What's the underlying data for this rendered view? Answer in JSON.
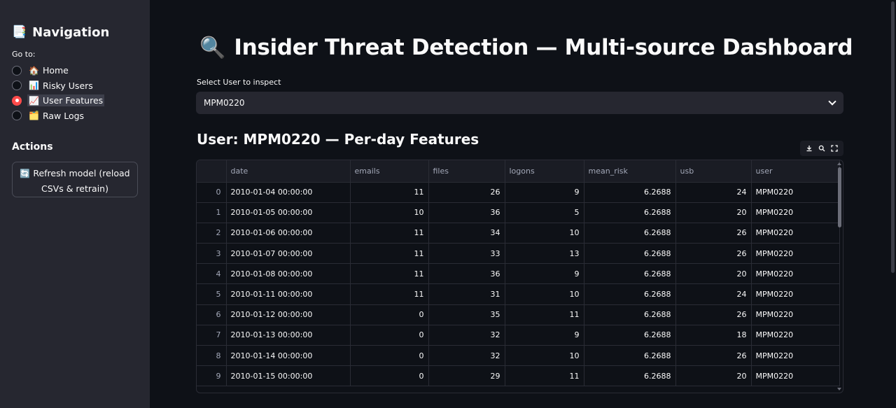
{
  "sidebar": {
    "title": "Navigation",
    "title_icon": "📑",
    "goto_label": "Go to:",
    "items": [
      {
        "label": "Home",
        "icon": "🏠",
        "selected": false
      },
      {
        "label": "Risky Users",
        "icon": "📊",
        "selected": false
      },
      {
        "label": "User Features",
        "icon": "📈",
        "selected": true
      },
      {
        "label": "Raw Logs",
        "icon": "🗂️",
        "selected": false
      }
    ],
    "actions_label": "Actions",
    "refresh_icon": "🔄",
    "refresh_line1": "Refresh model (reload",
    "refresh_line2": "CSVs & retrain)"
  },
  "main": {
    "title_icon": "🔍",
    "title": "Insider Threat Detection — Multi-source Dashboard",
    "select_label": "Select User to inspect",
    "selected_user": "MPM0220",
    "subheader": "User: MPM0220 — Per-day Features"
  },
  "table": {
    "columns": [
      "",
      "date",
      "emails",
      "files",
      "logons",
      "mean_risk",
      "usb",
      "user"
    ],
    "rows": [
      [
        "0",
        "2010-01-04 00:00:00",
        "11",
        "26",
        "9",
        "6.2688",
        "24",
        "MPM0220"
      ],
      [
        "1",
        "2010-01-05 00:00:00",
        "10",
        "36",
        "5",
        "6.2688",
        "20",
        "MPM0220"
      ],
      [
        "2",
        "2010-01-06 00:00:00",
        "11",
        "34",
        "10",
        "6.2688",
        "26",
        "MPM0220"
      ],
      [
        "3",
        "2010-01-07 00:00:00",
        "11",
        "33",
        "13",
        "6.2688",
        "26",
        "MPM0220"
      ],
      [
        "4",
        "2010-01-08 00:00:00",
        "11",
        "36",
        "9",
        "6.2688",
        "20",
        "MPM0220"
      ],
      [
        "5",
        "2010-01-11 00:00:00",
        "11",
        "31",
        "10",
        "6.2688",
        "24",
        "MPM0220"
      ],
      [
        "6",
        "2010-01-12 00:00:00",
        "0",
        "35",
        "11",
        "6.2688",
        "26",
        "MPM0220"
      ],
      [
        "7",
        "2010-01-13 00:00:00",
        "0",
        "32",
        "9",
        "6.2688",
        "18",
        "MPM0220"
      ],
      [
        "8",
        "2010-01-14 00:00:00",
        "0",
        "32",
        "10",
        "6.2688",
        "26",
        "MPM0220"
      ],
      [
        "9",
        "2010-01-15 00:00:00",
        "0",
        "29",
        "11",
        "6.2688",
        "20",
        "MPM0220"
      ]
    ]
  },
  "colors": {
    "accent": "#ff4b4b",
    "background": "#0e1117",
    "sidebar": "#262730"
  }
}
